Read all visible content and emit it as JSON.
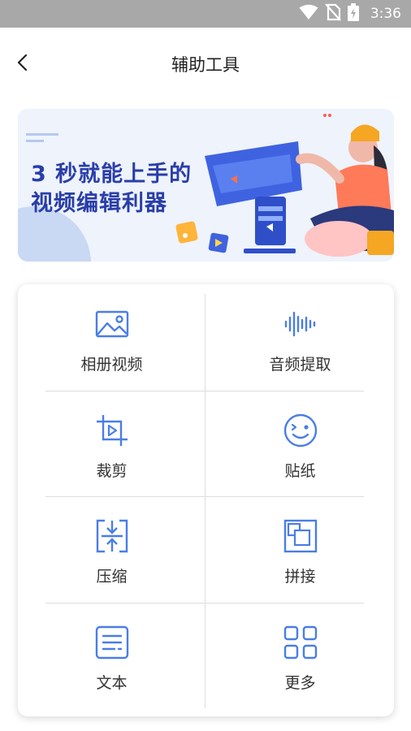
{
  "status_bar": {
    "time": "3:36",
    "icons": [
      "wifi-icon",
      "no-sim-icon",
      "battery-charging-icon"
    ]
  },
  "nav": {
    "title": "辅助工具",
    "back_icon": "chevron-left-icon"
  },
  "banner": {
    "line1": "3 秒就能上手的",
    "line2": "视频编辑利器"
  },
  "colors": {
    "status_bar_bg": "#a8a8a8",
    "accent": "#4a7de8",
    "banner_text": "#2a3ea8",
    "banner_bg": "#eef3fc"
  },
  "tools": [
    {
      "label": "相册视频",
      "icon": "photo-album-icon"
    },
    {
      "label": "音频提取",
      "icon": "audio-wave-icon"
    },
    {
      "label": "裁剪",
      "icon": "crop-icon"
    },
    {
      "label": "贴纸",
      "icon": "sticker-face-icon"
    },
    {
      "label": "压缩",
      "icon": "compress-icon"
    },
    {
      "label": "拼接",
      "icon": "join-icon"
    },
    {
      "label": "文本",
      "icon": "text-icon"
    },
    {
      "label": "更多",
      "icon": "more-grid-icon"
    }
  ]
}
